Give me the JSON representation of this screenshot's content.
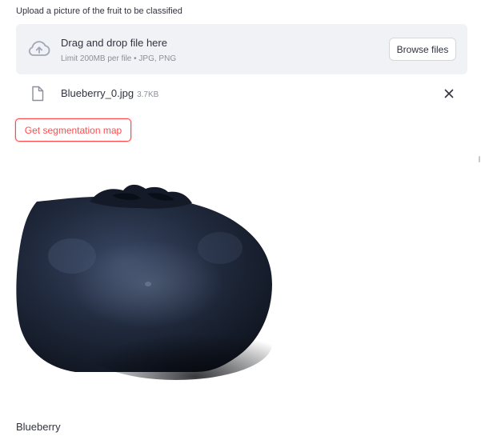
{
  "uploader": {
    "label": "Upload a picture of the fruit to be classified",
    "dropzone_title": "Drag and drop file here",
    "dropzone_limits": "Limit 200MB per file • JPG, PNG",
    "browse_label": "Browse files",
    "upload_icon": "cloud-upload-icon"
  },
  "file": {
    "name": "Blueberry_0.jpg",
    "size": "3.7KB",
    "file_icon": "file-icon",
    "remove_icon": "close-icon"
  },
  "actions": {
    "segmentation_label": "Get segmentation map"
  },
  "image": {
    "alt": "Blueberry"
  },
  "result": {
    "label": "Blueberry"
  },
  "colors": {
    "accent": "#ff4b4b",
    "dropzone_bg": "#f0f2f6",
    "text": "#31333f",
    "muted_text": "#8c8f99"
  }
}
